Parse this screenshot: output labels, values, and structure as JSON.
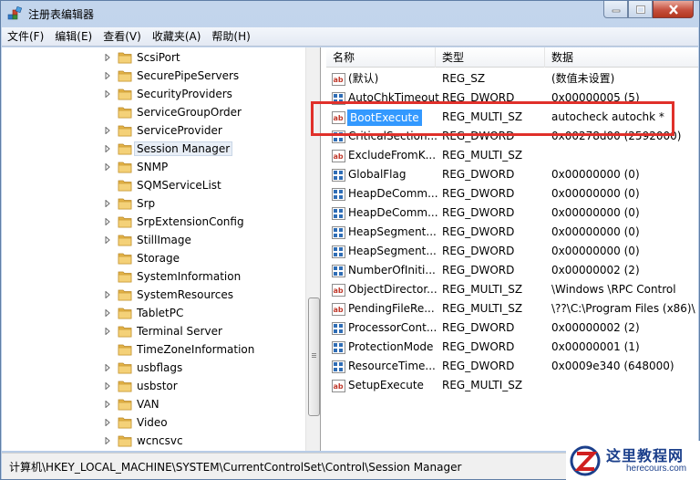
{
  "window": {
    "title": "注册表编辑器"
  },
  "menu": [
    "文件(F)",
    "编辑(E)",
    "查看(V)",
    "收藏夹(A)",
    "帮助(H)"
  ],
  "tree": {
    "items": [
      {
        "label": "ScsiPort",
        "expandable": true
      },
      {
        "label": "SecurePipeServers",
        "expandable": true
      },
      {
        "label": "SecurityProviders",
        "expandable": true
      },
      {
        "label": "ServiceGroupOrder",
        "expandable": false
      },
      {
        "label": "ServiceProvider",
        "expandable": true
      },
      {
        "label": "Session Manager",
        "expandable": true,
        "selected": true
      },
      {
        "label": "SNMP",
        "expandable": true
      },
      {
        "label": "SQMServiceList",
        "expandable": false
      },
      {
        "label": "Srp",
        "expandable": true
      },
      {
        "label": "SrpExtensionConfig",
        "expandable": true
      },
      {
        "label": "StillImage",
        "expandable": true
      },
      {
        "label": "Storage",
        "expandable": false
      },
      {
        "label": "SystemInformation",
        "expandable": false
      },
      {
        "label": "SystemResources",
        "expandable": true
      },
      {
        "label": "TabletPC",
        "expandable": true
      },
      {
        "label": "Terminal Server",
        "expandable": true
      },
      {
        "label": "TimeZoneInformation",
        "expandable": false
      },
      {
        "label": "usbflags",
        "expandable": true
      },
      {
        "label": "usbstor",
        "expandable": true
      },
      {
        "label": "VAN",
        "expandable": true
      },
      {
        "label": "Video",
        "expandable": true
      },
      {
        "label": "wcncsvc",
        "expandable": true
      }
    ]
  },
  "list": {
    "columns": {
      "name": "名称",
      "type": "类型",
      "data": "数据"
    },
    "rows": [
      {
        "icon": "string-value-icon",
        "name": "(默认)",
        "type": "REG_SZ",
        "data": "(数值未设置)"
      },
      {
        "icon": "binary-value-icon",
        "name": "AutoChkTimeout",
        "type": "REG_DWORD",
        "data": "0x00000005 (5)"
      },
      {
        "icon": "string-value-icon",
        "name": "BootExecute",
        "type": "REG_MULTI_SZ",
        "data": "autocheck autochk *",
        "selected": true
      },
      {
        "icon": "binary-value-icon",
        "name": "CriticalSection...",
        "type": "REG_DWORD",
        "data": "0x00278d00 (2592000)"
      },
      {
        "icon": "string-value-icon",
        "name": "ExcludeFromK...",
        "type": "REG_MULTI_SZ",
        "data": ""
      },
      {
        "icon": "binary-value-icon",
        "name": "GlobalFlag",
        "type": "REG_DWORD",
        "data": "0x00000000 (0)"
      },
      {
        "icon": "binary-value-icon",
        "name": "HeapDeComm...",
        "type": "REG_DWORD",
        "data": "0x00000000 (0)"
      },
      {
        "icon": "binary-value-icon",
        "name": "HeapDeComm...",
        "type": "REG_DWORD",
        "data": "0x00000000 (0)"
      },
      {
        "icon": "binary-value-icon",
        "name": "HeapSegment...",
        "type": "REG_DWORD",
        "data": "0x00000000 (0)"
      },
      {
        "icon": "binary-value-icon",
        "name": "HeapSegment...",
        "type": "REG_DWORD",
        "data": "0x00000000 (0)"
      },
      {
        "icon": "binary-value-icon",
        "name": "NumberOfIniti...",
        "type": "REG_DWORD",
        "data": "0x00000002 (2)"
      },
      {
        "icon": "string-value-icon",
        "name": "ObjectDirector...",
        "type": "REG_MULTI_SZ",
        "data": "\\Windows \\RPC Control"
      },
      {
        "icon": "string-value-icon",
        "name": "PendingFileRe...",
        "type": "REG_MULTI_SZ",
        "data": "\\??\\C:\\Program Files (x86)\\"
      },
      {
        "icon": "binary-value-icon",
        "name": "ProcessorCont...",
        "type": "REG_DWORD",
        "data": "0x00000002 (2)"
      },
      {
        "icon": "binary-value-icon",
        "name": "ProtectionMode",
        "type": "REG_DWORD",
        "data": "0x00000001 (1)"
      },
      {
        "icon": "binary-value-icon",
        "name": "ResourceTime...",
        "type": "REG_DWORD",
        "data": "0x0009e340 (648000)"
      },
      {
        "icon": "string-value-icon",
        "name": "SetupExecute",
        "type": "REG_MULTI_SZ",
        "data": ""
      }
    ]
  },
  "status": {
    "path": "计算机\\HKEY_LOCAL_MACHINE\\SYSTEM\\CurrentControlSet\\Control\\Session Manager"
  },
  "watermark": {
    "title": "这里教程网",
    "url": "herecours.com"
  },
  "colors": {
    "selection": "#3399ff",
    "highlight_box": "#e0302a",
    "folder": "#e8b84a"
  }
}
